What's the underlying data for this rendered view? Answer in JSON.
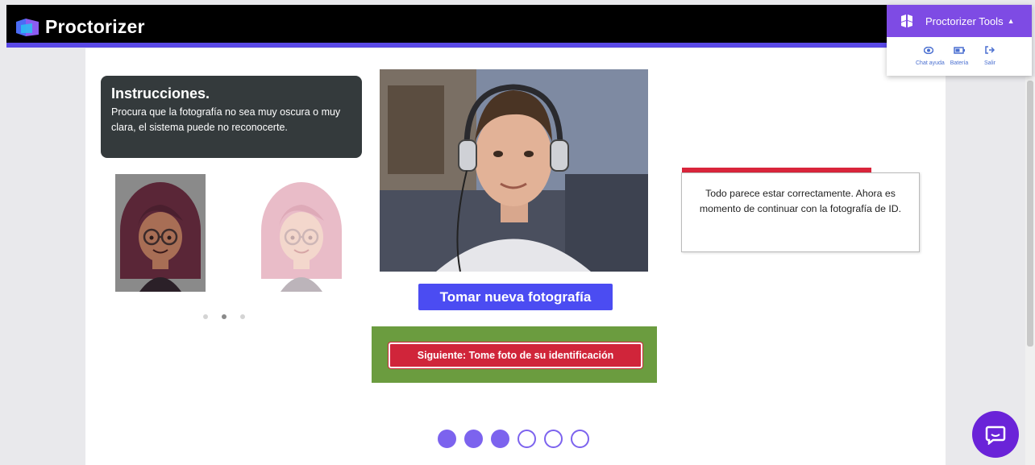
{
  "header": {
    "title": "Proctorizer"
  },
  "tools": {
    "title": "Proctorizer Tools",
    "items": [
      {
        "label": "Chat ayuda",
        "icon": "eye-icon"
      },
      {
        "label": "Batería",
        "icon": "battery-icon"
      },
      {
        "label": "Salir",
        "icon": "logout-icon"
      }
    ]
  },
  "instructions": {
    "heading": "Instrucciones.",
    "text": "Procura que la fotografía no sea muy oscura o muy clara, el sistema puede no reconocerte."
  },
  "carousel": {
    "total": 3,
    "active": 1
  },
  "buttons": {
    "retake": "Tomar nueva fotografía",
    "next": "Siguiente: Tome foto de su identificación"
  },
  "status_message": "Todo parece estar correctamente. Ahora es momento de continuar con la fotografía de ID.",
  "progress": {
    "total_steps": 6,
    "completed_steps": 3
  },
  "colors": {
    "accent": "#5a49e6",
    "tools": "#7e4be4",
    "primary_button": "#4b4cf2",
    "next_button": "#d0253a",
    "highlight": "#6b9c3f"
  }
}
